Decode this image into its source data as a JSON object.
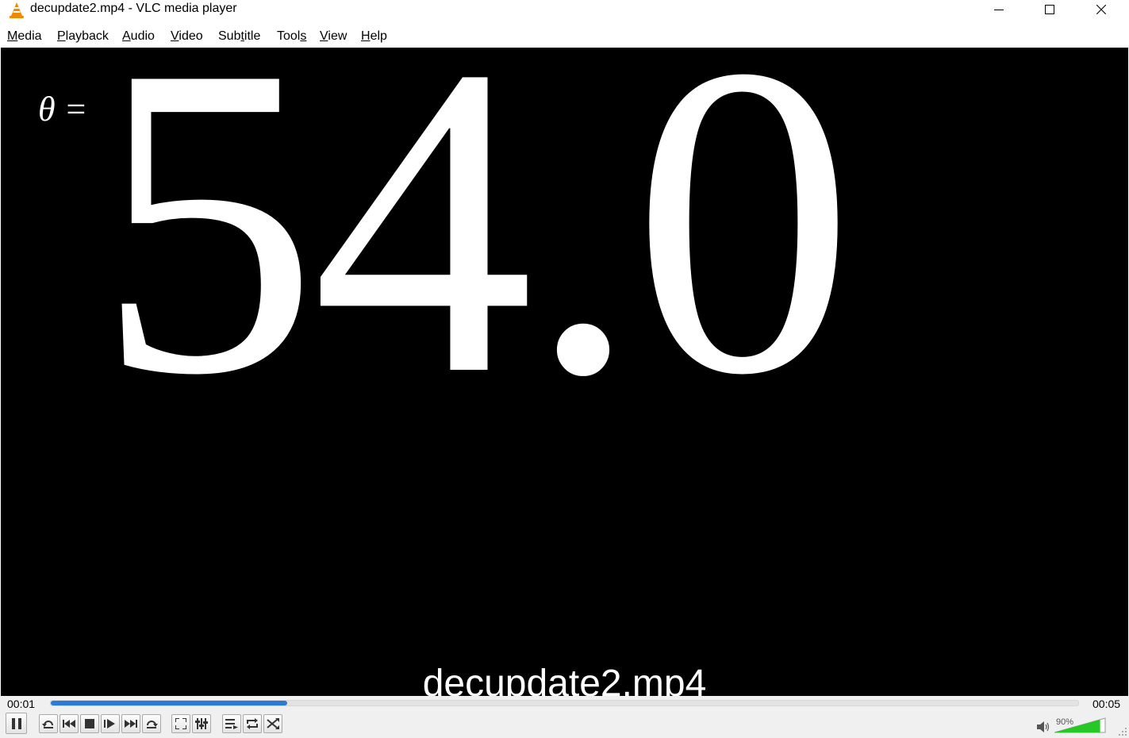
{
  "window": {
    "title": "decupdate2.mp4 - VLC media player"
  },
  "menu": [
    {
      "label": "Media",
      "accel": "M",
      "rest": "edia"
    },
    {
      "label": "Playback",
      "accel": "P",
      "rest": "layback"
    },
    {
      "label": "Audio",
      "accel": "A",
      "rest": "udio"
    },
    {
      "label": "Video",
      "accel": "V",
      "rest": "ideo"
    },
    {
      "label": "Subtitle",
      "pre": "Sub",
      "accel": "t",
      "rest": "itle"
    },
    {
      "label": "Tools",
      "pre": "Tool",
      "accel": "s",
      "rest": ""
    },
    {
      "label": "View",
      "accel": "V",
      "rest": "iew"
    },
    {
      "label": "Help",
      "accel": "H",
      "rest": "elp"
    }
  ],
  "video": {
    "theta_label": "θ =",
    "large_digits": "54.0",
    "overlay_filename": "decupdate2.mp4"
  },
  "playback": {
    "elapsed": "00:01",
    "total": "00:05",
    "progress": 0.23
  },
  "controls": {
    "buttons": [
      "pause",
      "previous-frame",
      "previous",
      "stop",
      "next-frame",
      "next",
      "loop-ab",
      "fullscreen",
      "extended-settings",
      "playlist",
      "loop",
      "random"
    ]
  },
  "volume": {
    "label": "90%",
    "level": 0.9
  },
  "colors": {
    "seek_fill": "#2b7bd6",
    "volume_fill": "#26c826",
    "video_bg": "#000000"
  }
}
